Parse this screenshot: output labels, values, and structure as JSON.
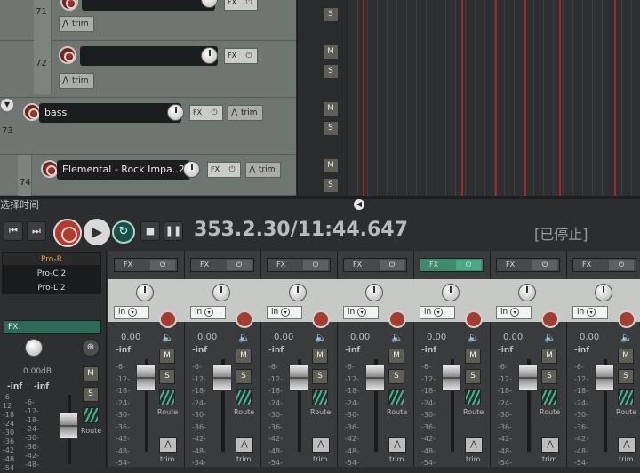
{
  "tracks": [
    {
      "number": "71",
      "name": "",
      "fx": "FX"
    },
    {
      "number": "72",
      "name": "",
      "fx": "FX",
      "trim": "trim"
    },
    {
      "number": "73",
      "name": "bass",
      "fx": "FX",
      "trim": "trim"
    },
    {
      "number": "74",
      "name": "Elemental - Rock Impa..2",
      "fx": "FX",
      "trim": "trim"
    }
  ],
  "first_trim": "trim",
  "mute_label": "M",
  "solo_label": "S",
  "selection_label": "选择时间",
  "transport": {
    "time": "353.2.30/11:44.647",
    "status": "[已停止]"
  },
  "master": {
    "plugins": [
      "Pro-R",
      "Pro-C 2",
      "Pro-L 2"
    ],
    "fx_label": "FX",
    "volume": "0.00dB",
    "inf_left": "-inf",
    "inf_right": "-inf",
    "mute": "M",
    "solo": "S",
    "route": "Route"
  },
  "mixer_strips": [
    {
      "fx": "FX",
      "fx_active": false,
      "input": "in",
      "volume": "0.00",
      "peak": "-inf",
      "mute": "M",
      "solo": "S",
      "route": "Route",
      "trim": "trim"
    },
    {
      "fx": "FX",
      "fx_active": false,
      "input": "in",
      "volume": "0.00",
      "peak": "-inf",
      "mute": "M",
      "solo": "S",
      "route": "Route",
      "trim": "trim"
    },
    {
      "fx": "FX",
      "fx_active": false,
      "input": "in",
      "volume": "0.00",
      "peak": "-inf",
      "mute": "M",
      "solo": "S",
      "route": "Route",
      "trim": "trim"
    },
    {
      "fx": "FX",
      "fx_active": false,
      "input": "in",
      "volume": "0.00",
      "peak": "-inf",
      "mute": "M",
      "solo": "S",
      "route": "Route",
      "trim": "trim"
    },
    {
      "fx": "FX",
      "fx_active": true,
      "input": "in",
      "volume": "0.00",
      "peak": "-inf",
      "mute": "M",
      "solo": "S",
      "route": "Route",
      "trim": "trim"
    },
    {
      "fx": "FX",
      "fx_active": false,
      "input": "in",
      "volume": "0.00",
      "peak": "-inf",
      "mute": "M",
      "solo": "S",
      "route": "Route",
      "trim": "trim"
    },
    {
      "fx": "FX",
      "fx_active": false,
      "input": "in",
      "volume": "0.00",
      "peak": "-inf",
      "mute": "M",
      "solo": "S",
      "route": "Route",
      "trim": "trim"
    }
  ],
  "meter_scale": [
    "-6-",
    "-12-",
    "-18-",
    "-24-",
    "-30-",
    "-36-",
    "-42-",
    "-48-",
    "-54-"
  ],
  "master_scale_left": [
    "-6",
    "12",
    "-18",
    "-24",
    "-30",
    "-36",
    "-42",
    "-48",
    "-54"
  ],
  "master_scale_right": [
    "-6-",
    "-12-",
    "-18-",
    "-24-",
    "-30-",
    "-36-",
    "-42-",
    "-48-"
  ],
  "colors": {
    "accent_green": "#3b8b6c",
    "record_red": "#b33a2c"
  }
}
